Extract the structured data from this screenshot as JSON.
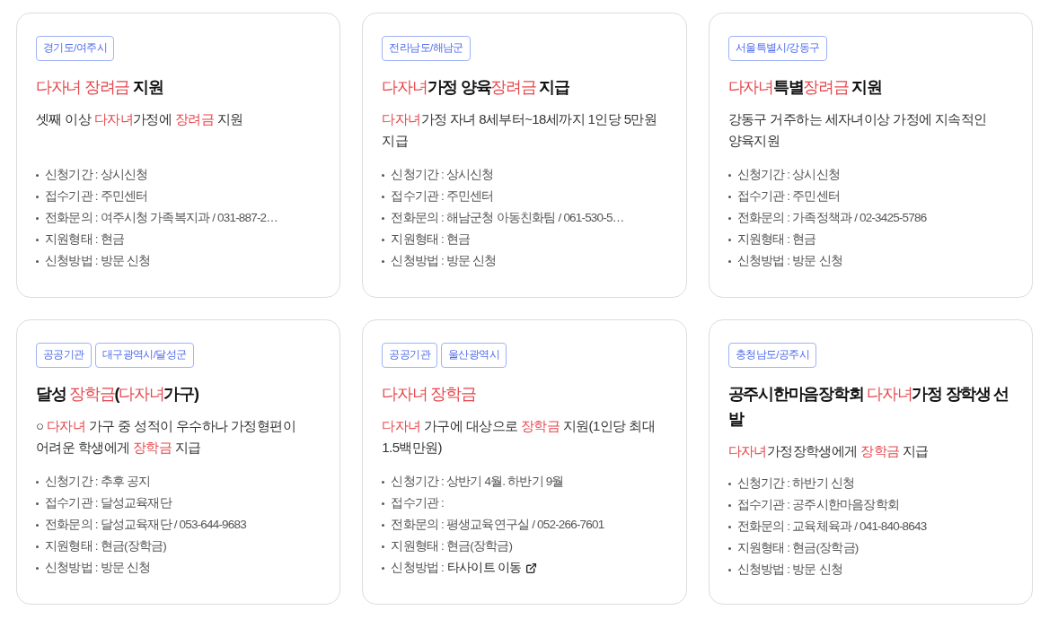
{
  "cards": [
    {
      "tags": [
        "경기도/여주시"
      ],
      "title": [
        {
          "text": "다자녀 장려금",
          "highlight": true
        },
        {
          "text": " 지원",
          "highlight": false
        }
      ],
      "description": [
        {
          "text": "셋째 이상 ",
          "highlight": false
        },
        {
          "text": "다자녀",
          "highlight": true
        },
        {
          "text": "가정에 ",
          "highlight": false
        },
        {
          "text": "장려금",
          "highlight": true
        },
        {
          "text": " 지원",
          "highlight": false
        }
      ],
      "details": [
        {
          "kind": "text",
          "text": "신청기간 : 상시신청"
        },
        {
          "kind": "text",
          "text": "접수기관 : 주민센터"
        },
        {
          "kind": "text",
          "text": "전화문의 : 여주시청 가족복지과 / 031-887-2…"
        },
        {
          "kind": "text",
          "text": "지원형태 : 현금"
        },
        {
          "kind": "text",
          "text": "신청방법 : 방문 신청"
        }
      ]
    },
    {
      "tags": [
        "전라남도/해남군"
      ],
      "title": [
        {
          "text": "다자녀",
          "highlight": true
        },
        {
          "text": "가정 양육",
          "highlight": false
        },
        {
          "text": "장려금",
          "highlight": true
        },
        {
          "text": " 지급",
          "highlight": false
        }
      ],
      "description": [
        {
          "text": "다자녀",
          "highlight": true
        },
        {
          "text": "가정 자녀 8세부터~18세까지 1인당 5만원 지급",
          "highlight": false
        }
      ],
      "details": [
        {
          "kind": "text",
          "text": "신청기간 : 상시신청"
        },
        {
          "kind": "text",
          "text": "접수기관 : 주민센터"
        },
        {
          "kind": "text",
          "text": "전화문의 : 해남군청 아동친화팀 / 061-530-5…"
        },
        {
          "kind": "text",
          "text": "지원형태 : 현금"
        },
        {
          "kind": "text",
          "text": "신청방법 : 방문 신청"
        }
      ]
    },
    {
      "tags": [
        "서울특별시/강동구"
      ],
      "title": [
        {
          "text": "다자녀",
          "highlight": true
        },
        {
          "text": "특별",
          "highlight": false
        },
        {
          "text": "장려금",
          "highlight": true
        },
        {
          "text": " 지원",
          "highlight": false
        }
      ],
      "description": [
        {
          "text": "강동구 거주하는 세자녀이상 가정에 지속적인 양육지원",
          "highlight": false
        }
      ],
      "details": [
        {
          "kind": "text",
          "text": "신청기간 : 상시신청"
        },
        {
          "kind": "text",
          "text": "접수기관 : 주민센터"
        },
        {
          "kind": "text",
          "text": "전화문의 : 가족정책과 / 02-3425-5786"
        },
        {
          "kind": "text",
          "text": "지원형태 : 현금"
        },
        {
          "kind": "text",
          "text": "신청방법 : 방문 신청"
        }
      ]
    },
    {
      "tags": [
        "공공기관",
        "대구광역시/달성군"
      ],
      "title": [
        {
          "text": "달성 ",
          "highlight": false
        },
        {
          "text": "장학금",
          "highlight": true
        },
        {
          "text": "(",
          "highlight": false
        },
        {
          "text": "다자녀",
          "highlight": true
        },
        {
          "text": "가구)",
          "highlight": false
        }
      ],
      "description": [
        {
          "text": "○ ",
          "highlight": false
        },
        {
          "text": "다자녀",
          "highlight": true
        },
        {
          "text": " 가구 중 성적이 우수하나 가정형편이 어려운 학생에게 ",
          "highlight": false
        },
        {
          "text": "장학금",
          "highlight": true
        },
        {
          "text": " 지급",
          "highlight": false
        }
      ],
      "details": [
        {
          "kind": "text",
          "text": "신청기간 : 추후 공지"
        },
        {
          "kind": "text",
          "text": "접수기관 : 달성교육재단"
        },
        {
          "kind": "text",
          "text": "전화문의 : 달성교육재단 / 053-644-9683"
        },
        {
          "kind": "text",
          "text": "지원형태 : 현금(장학금)"
        },
        {
          "kind": "text",
          "text": "신청방법 : 방문 신청"
        }
      ]
    },
    {
      "tags": [
        "공공기관",
        "울산광역시"
      ],
      "title": [
        {
          "text": "다자녀 장학금",
          "highlight": true
        }
      ],
      "description": [
        {
          "text": "다자녀",
          "highlight": true
        },
        {
          "text": " 가구에 대상으로 ",
          "highlight": false
        },
        {
          "text": "장학금",
          "highlight": true
        },
        {
          "text": " 지원(1인당 최대 1.5백만원)",
          "highlight": false
        }
      ],
      "details": [
        {
          "kind": "text",
          "text": "신청기간 : 상반기 4월. 하반기 9월"
        },
        {
          "kind": "text",
          "text": "접수기관 :"
        },
        {
          "kind": "text",
          "text": "전화문의 : 평생교육연구실 / 052-266-7601"
        },
        {
          "kind": "text",
          "text": "지원형태 : 현금(장학금)"
        },
        {
          "kind": "link",
          "label": "신청방법 :",
          "link": "타사이트 이동"
        }
      ]
    },
    {
      "tags": [
        "충청남도/공주시"
      ],
      "title": [
        {
          "text": "공주시한마음장학회 ",
          "highlight": false
        },
        {
          "text": "다자녀",
          "highlight": true
        },
        {
          "text": "가정 장학생 선발",
          "highlight": false
        }
      ],
      "description": [
        {
          "text": "다자녀",
          "highlight": true
        },
        {
          "text": "가정장학생에게 ",
          "highlight": false
        },
        {
          "text": "장학금",
          "highlight": true
        },
        {
          "text": " 지급",
          "highlight": false
        }
      ],
      "details": [
        {
          "kind": "text",
          "text": "신청기간 : 하반기 신청"
        },
        {
          "kind": "text",
          "text": "접수기관 : 공주시한마음장학회"
        },
        {
          "kind": "text",
          "text": "전화문의 : 교육체육과 / 041-840-8643"
        },
        {
          "kind": "text",
          "text": "지원형태 : 현금(장학금)"
        },
        {
          "kind": "text",
          "text": "신청방법 : 방문 신청"
        }
      ]
    }
  ]
}
